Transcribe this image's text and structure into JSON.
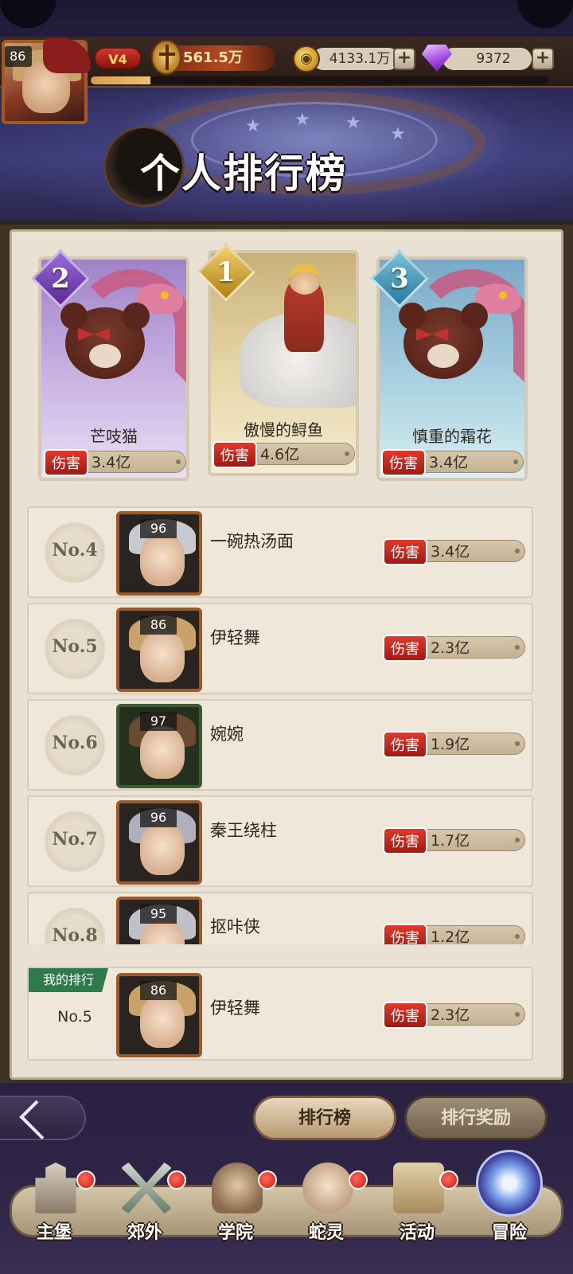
{
  "header": {
    "player_level": "86",
    "vip": "V4",
    "power": "561.5万",
    "gold": "4133.1万",
    "gems": "9372",
    "exp_fraction": 0.13,
    "plus": "+"
  },
  "title": "个人排行榜",
  "podium": [
    {
      "rank": "2",
      "name": "芒吱猫",
      "tag": "伤害",
      "value": "3.4亿"
    },
    {
      "rank": "1",
      "name": "傲慢的鲟鱼",
      "tag": "伤害",
      "value": "4.6亿"
    },
    {
      "rank": "3",
      "name": "慎重的霜花",
      "tag": "伤害",
      "value": "3.4亿"
    }
  ],
  "list": [
    {
      "rank": "No.4",
      "level": "96",
      "name": "一碗热汤面",
      "tag": "伤害",
      "value": "3.4亿"
    },
    {
      "rank": "No.5",
      "level": "86",
      "name": "伊轻舞",
      "tag": "伤害",
      "value": "2.3亿"
    },
    {
      "rank": "No.6",
      "level": "97",
      "name": "婉婉",
      "tag": "伤害",
      "value": "1.9亿"
    },
    {
      "rank": "No.7",
      "level": "96",
      "name": "秦王绕柱",
      "tag": "伤害",
      "value": "1.7亿"
    },
    {
      "rank": "No.8",
      "level": "95",
      "name": "抠咔侠",
      "tag": "伤害",
      "value": "1.2亿"
    }
  ],
  "my_rank": {
    "tag": "我的排行",
    "rank": "No.5",
    "level": "86",
    "name": "伊轻舞",
    "dmg_tag": "伤害",
    "value": "2.3亿"
  },
  "tabs": {
    "rank": "排行榜",
    "reward": "排行奖励"
  },
  "nav": [
    {
      "label": "主堡",
      "icon": "castle-icon"
    },
    {
      "label": "郊外",
      "icon": "crossed-swords-icon"
    },
    {
      "label": "学院",
      "icon": "academy-icon"
    },
    {
      "label": "蛇灵",
      "icon": "snake-spirit-icon"
    },
    {
      "label": "活动",
      "icon": "gift-icon"
    },
    {
      "label": "冒险",
      "icon": "adventure-portal-icon"
    }
  ],
  "colors": {
    "accent_red": "#d6382e",
    "panel": "#e9e2d4",
    "my_rank_green": "#2f7a4a"
  }
}
